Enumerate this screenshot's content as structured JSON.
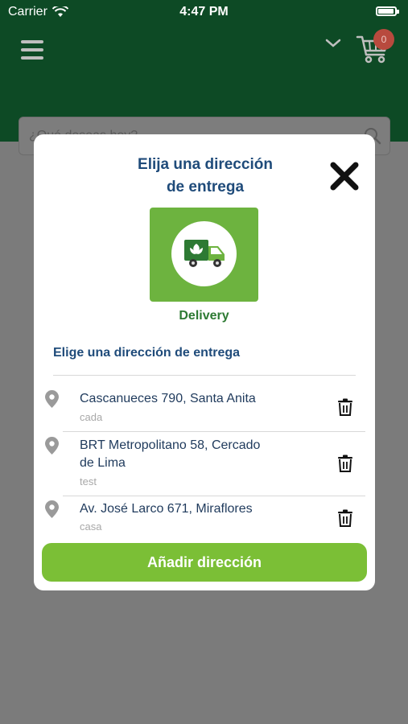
{
  "status_bar": {
    "carrier": "Carrier",
    "time": "4:47 PM",
    "battery_level": 0.95
  },
  "header": {
    "cart_count": "0"
  },
  "search": {
    "placeholder": "¿Qué deseas hoy?"
  },
  "modal": {
    "title_line1": "Elija una dirección",
    "title_line2": "de entrega",
    "delivery_label": "Delivery",
    "section_title": "Elige una dirección de entrega",
    "addresses": [
      {
        "line1": "Cascanueces 790, Santa Anita",
        "line2": "",
        "label": "cada"
      },
      {
        "line1": "BRT Metropolitano 58, Cercado",
        "line2": "de Lima",
        "label": "test"
      },
      {
        "line1": "Av. José Larco 671, Miraflores",
        "line2": "",
        "label": "casa"
      }
    ],
    "add_button": "Añadir dirección"
  },
  "colors": {
    "header_green": "#0d4a25",
    "accent_green": "#7bbf36",
    "title_blue": "#1f4b7a",
    "delivery_green": "#2d7a33",
    "badge_red": "#b84a3e"
  },
  "icons": [
    "wifi-icon",
    "battery-icon",
    "hamburger-menu-icon",
    "chevron-down-icon",
    "cart-icon",
    "search-icon",
    "close-icon",
    "truck-icon",
    "location-pin-icon",
    "trash-icon"
  ]
}
